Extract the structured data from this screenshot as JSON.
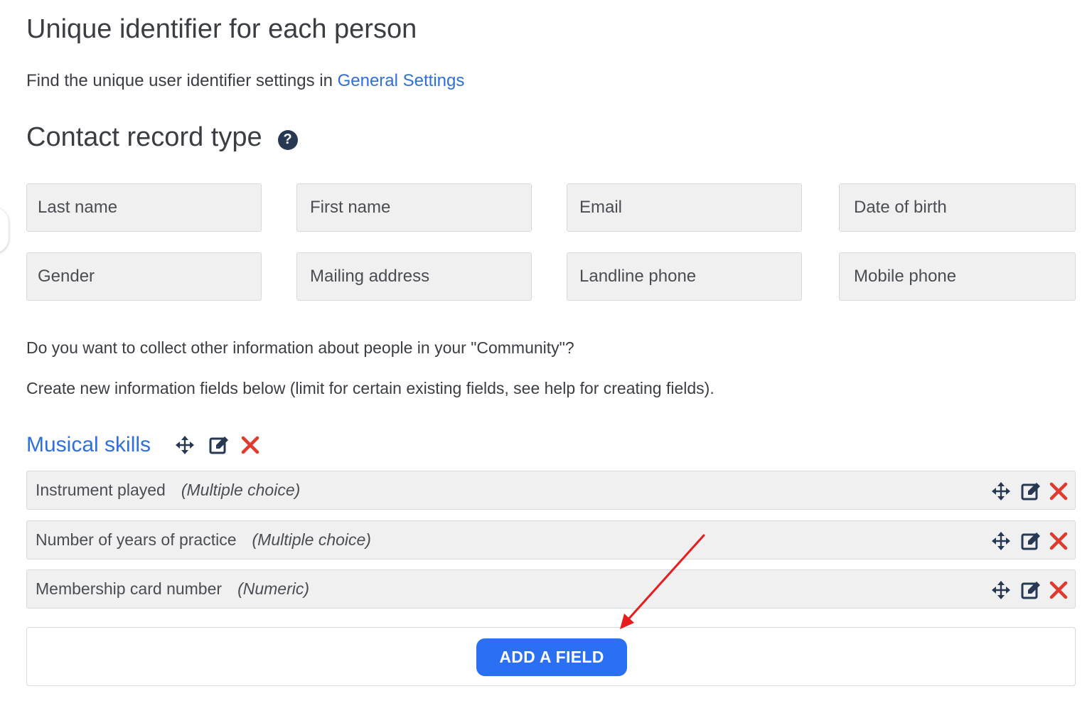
{
  "header": {
    "title": "Unique identifier for each person",
    "subline_text": "Find the unique user identifier settings in ",
    "subline_link": "General Settings"
  },
  "contact": {
    "title": "Contact record type",
    "help_glyph": "?",
    "fields": [
      "Last name",
      "First name",
      "Email",
      "Date of birth",
      "Gender",
      "Mailing address",
      "Landline phone",
      "Mobile phone"
    ]
  },
  "questions": {
    "q1": "Do you want to collect other information about people in your \"Community\"?",
    "q2": "Create new information fields below (limit for certain existing fields, see help for creating fields)."
  },
  "group": {
    "title": "Musical skills",
    "rows": [
      {
        "label": "Instrument played",
        "type": "(Multiple choice)"
      },
      {
        "label": "Number of years of practice",
        "type": "(Multiple choice)"
      },
      {
        "label": "Membership card number",
        "type": "(Numeric)"
      }
    ]
  },
  "actions": {
    "add_field": "ADD A FIELD"
  },
  "colors": {
    "link": "#2f6fdd",
    "button": "#2b6ff2",
    "delete": "#e03a2f",
    "icon_dark": "#263852",
    "annotation_arrow": "#e81c1c"
  },
  "icons": {
    "move": "move-icon",
    "edit": "edit-icon",
    "delete": "delete-icon",
    "help": "help-icon"
  }
}
